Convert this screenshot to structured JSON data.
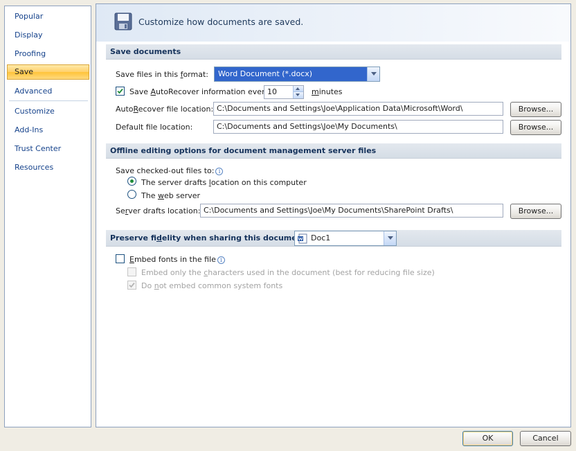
{
  "sidebar": {
    "items": [
      {
        "label": "Popular"
      },
      {
        "label": "Display"
      },
      {
        "label": "Proofing"
      },
      {
        "label": "Save"
      },
      {
        "label": "Advanced"
      },
      {
        "label": "Customize"
      },
      {
        "label": "Add-Ins"
      },
      {
        "label": "Trust Center"
      },
      {
        "label": "Resources"
      }
    ],
    "selected": "Save"
  },
  "header": {
    "title": "Customize how documents are saved."
  },
  "save_documents": {
    "heading": "Save documents",
    "format_label_pre": "Save files in this ",
    "format_label_ul": "f",
    "format_label_post": "ormat:",
    "format_value": "Word Document (*.docx)",
    "autorecover_label_pre": "Save ",
    "autorecover_label_ul": "A",
    "autorecover_label_post": "utoRecover information every",
    "autorecover_checked": true,
    "autorecover_minutes": "10",
    "minutes_label_ul": "m",
    "minutes_label_post": "inutes",
    "autorecover_location_label_pre": "Auto",
    "autorecover_location_label_ul": "R",
    "autorecover_location_label_post": "ecover file location:",
    "autorecover_location_value": "C:\\Documents and Settings\\Joe\\Application Data\\Microsoft\\Word\\",
    "default_location_label_pre": "Default f",
    "default_location_label_ul": "i",
    "default_location_label_post": "le location:",
    "default_location_value": "C:\\Documents and Settings\\Joe\\My Documents\\",
    "browse_label": "Browse..."
  },
  "offline": {
    "heading": "Offline editing options for document management server files",
    "save_checked_out_label": "Save checked-out files to:",
    "option1_pre": "The server drafts ",
    "option1_ul": "l",
    "option1_post": "ocation on this computer",
    "option1_selected": true,
    "option2_pre": "The ",
    "option2_ul": "w",
    "option2_post": "eb server",
    "server_drafts_label_pre": "Se",
    "server_drafts_label_ul": "r",
    "server_drafts_label_post": "ver drafts location:",
    "server_drafts_value": "C:\\Documents and Settings\\Joe\\My Documents\\SharePoint Drafts\\",
    "browse_label": "Browse..."
  },
  "fidelity": {
    "heading_pre": "Preserve fi",
    "heading_ul": "d",
    "heading_post": "elity when sharing this document:",
    "document_value": "Doc1",
    "embed_fonts_pre": "",
    "embed_fonts_ul": "E",
    "embed_fonts_post": "mbed fonts in the file",
    "embed_fonts_checked": false,
    "embed_only_pre": "Embed only the ",
    "embed_only_ul": "c",
    "embed_only_post": "haracters used in the document (best for reducing file size)",
    "embed_only_checked": false,
    "no_common_pre": "Do ",
    "no_common_ul": "n",
    "no_common_post": "ot embed common system fonts",
    "no_common_checked": true
  },
  "footer": {
    "ok_label": "OK",
    "cancel_label": "Cancel"
  },
  "icons": {
    "save": "floppy-disk-icon",
    "info": "info-icon",
    "document": "word-document-icon"
  },
  "colors": {
    "accent": "#3266cc",
    "selected_nav": "#ffd06b",
    "section_head": "#d5dde6"
  }
}
